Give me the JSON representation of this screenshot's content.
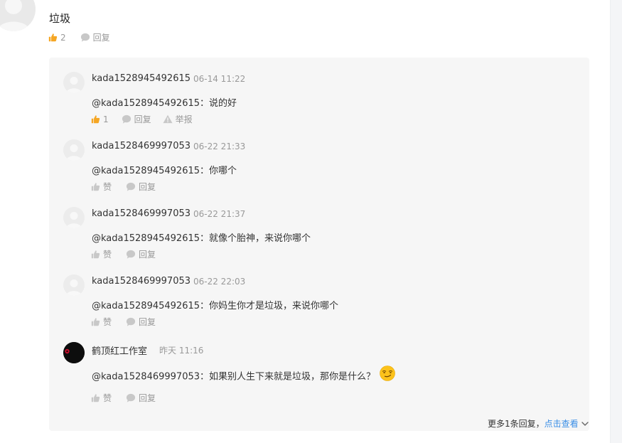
{
  "top_comment": {
    "text": "垃圾",
    "like_count": "2",
    "reply_label": "回复"
  },
  "replies": [
    {
      "name": "kada1528945492615",
      "time": "06-14 11:22",
      "text": "@kada1528945492615：说的好",
      "like": "1",
      "reply": "回复",
      "report": "举报",
      "liked": true
    },
    {
      "name": "kada1528469997053",
      "time": "06-22 21:33",
      "text": "@kada1528945492615：你哪个",
      "like": "赞",
      "reply": "回复"
    },
    {
      "name": "kada1528469997053",
      "time": "06-22 21:37",
      "text": "@kada1528945492615：就像个胎神，来说你哪个",
      "like": "赞",
      "reply": "回复"
    },
    {
      "name": "kada1528469997053",
      "time": "06-22 22:03",
      "text": "@kada1528945492615：你妈生你才是垃圾，来说你哪个",
      "like": "赞",
      "reply": "回复"
    },
    {
      "name": "鹤顶红工作室",
      "time": "昨天 11:16",
      "text": "@kada1528469997053：如果别人生下来就是垃圾，那你是什么？",
      "like": "赞",
      "reply": "回复"
    }
  ],
  "more": {
    "text": "更多1条回复，",
    "link": "点击查看"
  },
  "colors": {
    "like_active": "#f5a623",
    "icon_gray": "#c8c8c8",
    "link": "#3a8ee6",
    "panel_bg": "#f6f6f6"
  }
}
